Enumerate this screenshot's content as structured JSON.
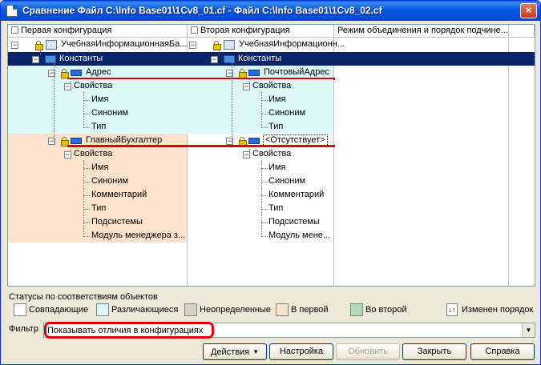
{
  "window": {
    "title": "Сравнение Файл C:\\Info Base01\\1Cv8_01.cf - Файл C:\\Info Base01\\1Cv8_02.cf",
    "close_label": "×"
  },
  "tree": {
    "headers": [
      "Первая конфигурация",
      "Вторая конфигурация",
      "Режим объединения и порядок подчине..."
    ],
    "rows": [
      {
        "left": "УчебнаяИнформационнаяБа...",
        "right": "УчебнаяИнформационн..."
      },
      {
        "left": "Константы",
        "right": "Константы"
      },
      {
        "left": "Адрес",
        "right": "ПочтовыйАдрес"
      },
      {
        "left": "Свойства",
        "right": "Свойства"
      },
      {
        "left": "Имя",
        "right": "Имя"
      },
      {
        "left": "Синоним",
        "right": "Синоним"
      },
      {
        "left": "Тип",
        "right": "Тип"
      },
      {
        "left": "ГлавныйБухгалтер",
        "right": "<Отсутствует>"
      },
      {
        "left": "Свойства",
        "right": "Свойства"
      },
      {
        "left": "Имя",
        "right": "Имя"
      },
      {
        "left": "Синоним",
        "right": "Синоним"
      },
      {
        "left": "Комментарий",
        "right": "Комментарий"
      },
      {
        "left": "Тип",
        "right": "Тип"
      },
      {
        "left": "Подсистемы",
        "right": "Подсистемы"
      },
      {
        "left": "Модуль менеджера з...",
        "right": "Модуль мене..."
      }
    ]
  },
  "statuses": {
    "label": "Статусы по соответствиям объектов",
    "items": [
      {
        "label": "Совпадающие",
        "color": "#ffffff"
      },
      {
        "label": "Различающиеся",
        "color": "#dcf8fa"
      },
      {
        "label": "Неопределенные",
        "color": "#d4d0c8"
      },
      {
        "label": "В первой",
        "color": "#fde3cc"
      },
      {
        "label": "Во второй",
        "color": "#b5d8b5"
      }
    ],
    "order_label": "Изменен порядок",
    "order_icon": "↓↑"
  },
  "filter": {
    "label": "Фильтр",
    "value": "Показывать отличия в конфигурациях"
  },
  "buttons": {
    "actions": "Действия",
    "settings": "Настройка",
    "refresh": "Обновить",
    "close": "Закрыть",
    "help": "Справка"
  },
  "colors": {
    "selection": "#0a246a",
    "differing": "#dcf8fa",
    "in_first": "#fde3cc",
    "highlight": "#e00000"
  }
}
